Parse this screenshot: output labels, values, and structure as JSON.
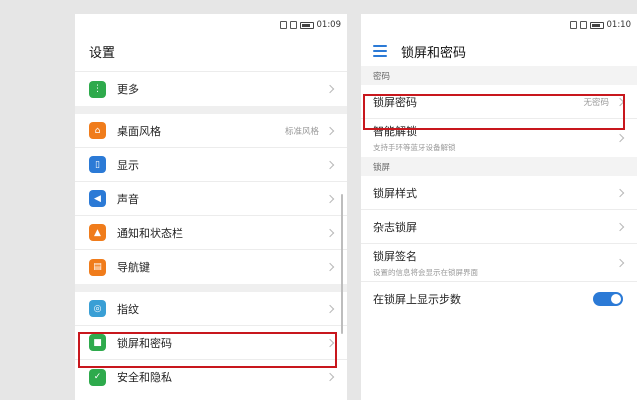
{
  "left": {
    "status_time": "01:09",
    "title": "设置",
    "items": [
      {
        "label": "更多",
        "value": ""
      },
      {
        "label": "桌面风格",
        "value": "标准风格"
      },
      {
        "label": "显示",
        "value": ""
      },
      {
        "label": "声音",
        "value": ""
      },
      {
        "label": "通知和状态栏",
        "value": ""
      },
      {
        "label": "导航键",
        "value": ""
      },
      {
        "label": "指纹",
        "value": ""
      },
      {
        "label": "锁屏和密码",
        "value": ""
      },
      {
        "label": "安全和隐私",
        "value": ""
      }
    ]
  },
  "right": {
    "status_time": "01:10",
    "title": "锁屏和密码",
    "section_password": "密码",
    "lock_password": {
      "label": "锁屏密码",
      "value": "无密码"
    },
    "smart_unlock": {
      "label": "智能解锁",
      "sub": "支持手环等蓝牙设备解锁"
    },
    "section_lockscreen": "锁屏",
    "lock_style": {
      "label": "锁屏样式"
    },
    "magazine_lock": {
      "label": "杂志锁屏"
    },
    "lock_signature": {
      "label": "锁屏签名",
      "sub": "设置的信息将会显示在锁屏界面"
    },
    "show_steps": {
      "label": "在锁屏上显示步数",
      "on": true
    }
  },
  "colors": {
    "highlight": "#c8171d",
    "accent": "#2b7ad6",
    "icon_more": "#2eaa4c",
    "icon_home": "#f07c1b",
    "icon_display": "#2b7ad6",
    "icon_sound": "#2b7ad6",
    "icon_notify": "#f07c1b",
    "icon_nav": "#f07c1b",
    "icon_fingerprint": "#3a9fd5",
    "icon_lock": "#2eaa4c",
    "icon_security": "#2eaa4c"
  }
}
